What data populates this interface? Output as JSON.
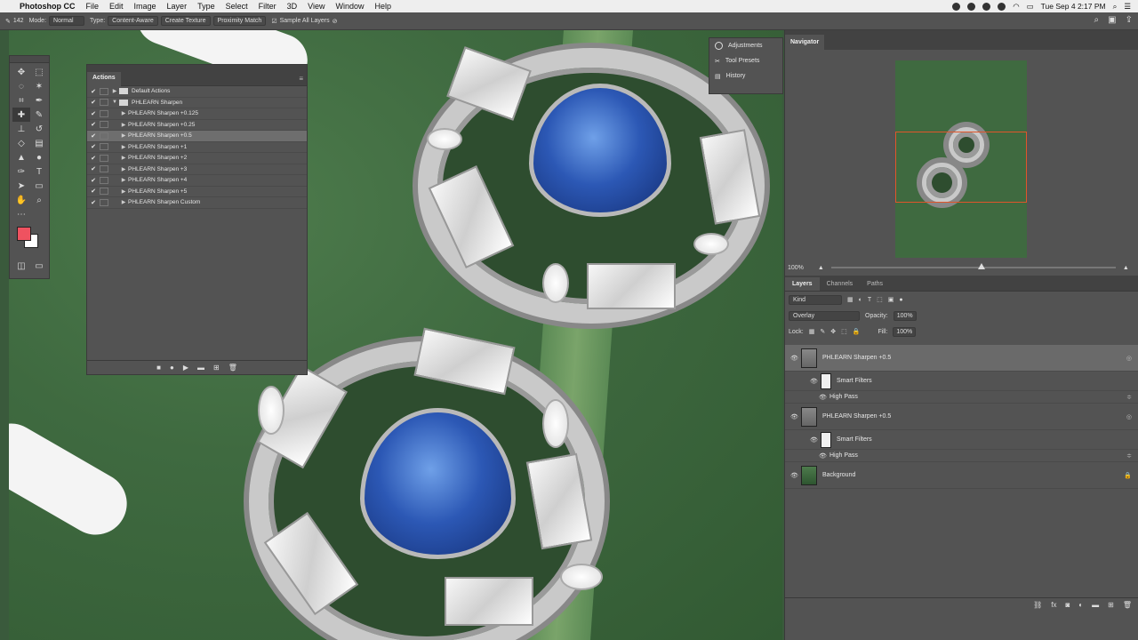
{
  "menubar": {
    "app_name": "Photoshop CC",
    "items": [
      "File",
      "Edit",
      "Image",
      "Layer",
      "Type",
      "Select",
      "Filter",
      "3D",
      "View",
      "Window",
      "Help"
    ],
    "clock": "Tue Sep 4  2:17 PM"
  },
  "options": {
    "brush_size": "142",
    "mode_label": "Mode:",
    "mode_value": "Normal",
    "type_label": "Type:",
    "type_content_aware": "Content-Aware",
    "type_create_texture": "Create Texture",
    "type_proximity": "Proximity Match",
    "sample_all": "Sample All Layers"
  },
  "actions_panel": {
    "title": "Actions",
    "rows": [
      {
        "label": "Default Actions",
        "kind": "set",
        "expanded": false
      },
      {
        "label": "PHLEARN Sharpen",
        "kind": "set",
        "expanded": true
      },
      {
        "label": "PHLEARN Sharpen +0.125",
        "kind": "action"
      },
      {
        "label": "PHLEARN Sharpen +0.25",
        "kind": "action"
      },
      {
        "label": "PHLEARN Sharpen +0.5",
        "kind": "action",
        "selected": true
      },
      {
        "label": "PHLEARN Sharpen +1",
        "kind": "action"
      },
      {
        "label": "PHLEARN Sharpen +2",
        "kind": "action"
      },
      {
        "label": "PHLEARN Sharpen +3",
        "kind": "action"
      },
      {
        "label": "PHLEARN Sharpen +4",
        "kind": "action"
      },
      {
        "label": "PHLEARN Sharpen +5",
        "kind": "action"
      },
      {
        "label": "PHLEARN Sharpen Custom",
        "kind": "action"
      }
    ]
  },
  "adjustments_panel": {
    "items": [
      "Adjustments",
      "Tool Presets",
      "History"
    ]
  },
  "navigator": {
    "title": "Navigator",
    "zoom": "100%"
  },
  "layers_panel": {
    "tabs": [
      "Layers",
      "Channels",
      "Paths"
    ],
    "filter_kind": "Kind",
    "blend_mode": "Overlay",
    "opacity_label": "Opacity:",
    "opacity_value": "100%",
    "lock_label": "Lock:",
    "fill_label": "Fill:",
    "fill_value": "100%",
    "layers": [
      {
        "name": "PHLEARN Sharpen +0.5",
        "selected": true
      },
      {
        "name": "Smart Filters",
        "sub": true
      },
      {
        "name": "High Pass",
        "subsm": true
      },
      {
        "name": "PHLEARN Sharpen +0.5"
      },
      {
        "name": "Smart Filters",
        "sub": true
      },
      {
        "name": "High Pass",
        "subsm": true
      },
      {
        "name": "Background",
        "locked": true
      }
    ]
  },
  "colors": {
    "foreground": "#ef5260",
    "background": "#ffffff",
    "ui": "#535353"
  }
}
